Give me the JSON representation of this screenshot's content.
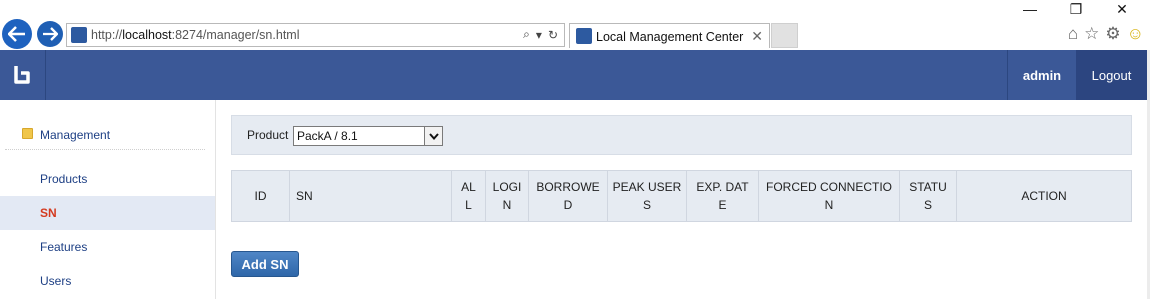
{
  "browser": {
    "url_prefix": "http://",
    "url_host": "localhost",
    "url_rest": ":8274/manager/sn.html",
    "tab_title": "Local Management Center",
    "tab_close": "✕",
    "icons": [
      "back-arrow",
      "forward-arrow",
      "search-icon",
      "refresh-icon",
      "home-icon",
      "star-icon",
      "gear-icon",
      "smiley-icon"
    ]
  },
  "header": {
    "username": "admin",
    "logout_label": "Logout",
    "colors": {
      "bar": "#3b5897",
      "logout_bg": "#2c4580"
    }
  },
  "sidebar": {
    "group_label": "Management",
    "items": [
      {
        "label": "Products",
        "active": false
      },
      {
        "label": "SN",
        "active": true
      },
      {
        "label": "Features",
        "active": false
      },
      {
        "label": "Users",
        "active": false
      }
    ]
  },
  "filter": {
    "product_label": "Product",
    "product_selected": "PackA / 8.1"
  },
  "table": {
    "columns": [
      "ID",
      "SN",
      "AL\nL",
      "LOGI\nN",
      "BORROWE\nD",
      "PEAK USER\nS",
      "EXP. DAT\nE",
      "FORCED CONNECTIO\nN",
      "STATU\nS",
      "ACTION"
    ]
  },
  "actions": {
    "add_sn_label": "Add SN",
    "accent": "#2f67a9"
  }
}
